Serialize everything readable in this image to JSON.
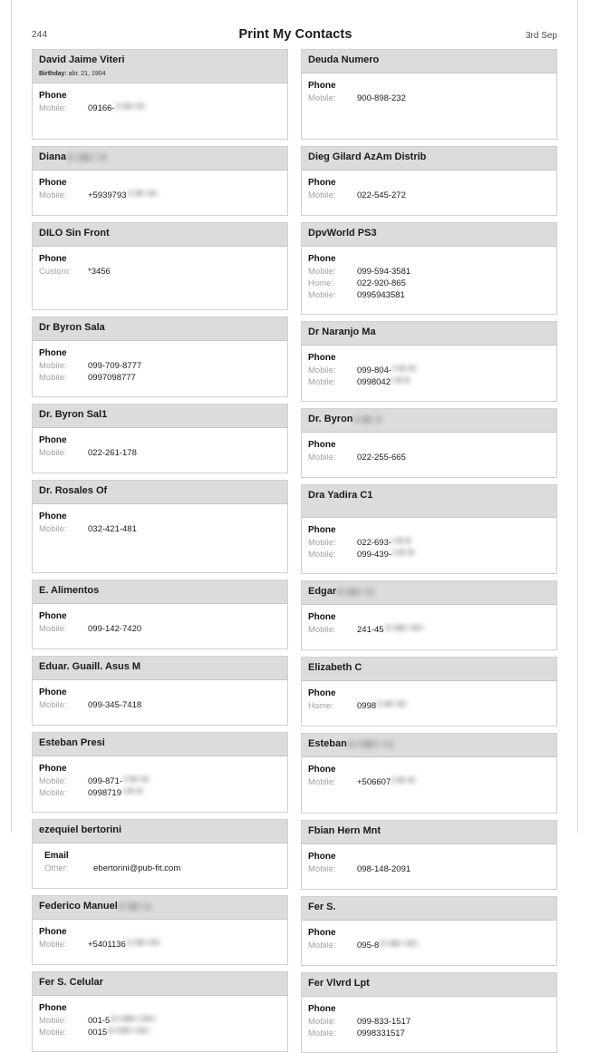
{
  "header": {
    "page_number": "244",
    "title": "Print My Contacts",
    "date": "3rd Sep"
  },
  "labels": {
    "phone_section": "Phone",
    "email_section": "Email",
    "birthday_prefix": "Birthday:"
  },
  "columns": [
    {
      "cards": [
        {
          "name": "David Jaime Viteri",
          "name_redacted": false,
          "birthday": "abr. 21, 1904",
          "section": "Phone",
          "entries": [
            {
              "label": "Mobile:",
              "value": "09166-",
              "redacted": true,
              "redact_width": 34
            }
          ],
          "body_height": 46
        },
        {
          "name": "Diana",
          "name_redacted": true,
          "name_redact_width": 44,
          "section": "Phone",
          "entries": [
            {
              "label": "Mobile:",
              "value": "+5939793",
              "redacted": true,
              "redact_width": 34
            }
          ],
          "body_height": 34
        },
        {
          "name": "DILO Sin Front",
          "name_redacted": false,
          "section": "Phone",
          "entries": [
            {
              "label": "Custom:",
              "value": "*3456",
              "redacted": false
            }
          ],
          "body_height": 54
        },
        {
          "name": "Dr Byron Sala",
          "name_redacted": false,
          "section": "Phone",
          "entries": [
            {
              "label": "Mobile:",
              "value": "099-709-8777",
              "redacted": false
            },
            {
              "label": "Mobile:",
              "value": "0997098777",
              "redacted": false
            }
          ],
          "body_height": 46
        },
        {
          "name": "Dr. Byron Sal1",
          "name_redacted": false,
          "section": "Phone",
          "entries": [
            {
              "label": "Mobile:",
              "value": "022-261-178",
              "redacted": false
            }
          ],
          "body_height": 34
        },
        {
          "name": "Dr. Rosales Of",
          "name_redacted": false,
          "section": "Phone",
          "entries": [
            {
              "label": "Mobile:",
              "value": "032-421-481",
              "redacted": false
            }
          ],
          "body_height": 60
        },
        {
          "name": "E. Alimentos",
          "name_redacted": false,
          "section": "Phone",
          "entries": [
            {
              "label": "Mobile:",
              "value": "099-142-7420",
              "redacted": false
            }
          ],
          "body_height": 34
        },
        {
          "name": "Eduar. Guaill. Asus M",
          "name_redacted": false,
          "section": "Phone",
          "entries": [
            {
              "label": "Mobile:",
              "value": "099-345-7418",
              "redacted": false
            }
          ],
          "body_height": 34
        },
        {
          "name": "Esteban Presi",
          "name_redacted": false,
          "section": "Phone",
          "entries": [
            {
              "label": "Mobile:",
              "value": "099-871-",
              "redacted": true,
              "redact_width": 30
            },
            {
              "label": "Mobile:",
              "value": "0998719",
              "redacted": true,
              "redact_width": 24
            }
          ],
          "body_height": 46
        },
        {
          "name": "ezequiel bertorini",
          "name_redacted": false,
          "section": "Email",
          "indent": true,
          "entries": [
            {
              "label": "Other:",
              "value": "ebertorini@pub-fit.com",
              "redacted": false
            }
          ],
          "body_height": 34
        },
        {
          "name": "Federico Manuel",
          "name_redacted": true,
          "name_redact_width": 36,
          "section": "Phone",
          "entries": [
            {
              "label": "Mobile:",
              "value": "+5401136",
              "redacted": true,
              "redact_width": 38
            }
          ],
          "body_height": 34
        },
        {
          "name": "Fer S. Celular",
          "name_redacted": false,
          "section": "Phone",
          "entries": [
            {
              "label": "Mobile:",
              "value": "001-5",
              "redacted": true,
              "redact_width": 52
            },
            {
              "label": "Mobile:",
              "value": "0015",
              "redacted": true,
              "redact_width": 48
            }
          ],
          "body_height": 46
        }
      ]
    },
    {
      "cards": [
        {
          "name": "Deuda Numero",
          "name_redacted": false,
          "section": "Phone",
          "entries": [
            {
              "label": "Mobile:",
              "value": "900-898-232",
              "redacted": false
            }
          ],
          "body_height": 57
        },
        {
          "name": "Dieg Gilard AzAm Distrib",
          "name_redacted": false,
          "section": "Phone",
          "entries": [
            {
              "label": "Mobile:",
              "value": "022-545-272",
              "redacted": false
            }
          ],
          "body_height": 34
        },
        {
          "name": "DpvWorld PS3",
          "name_redacted": false,
          "section": "Phone",
          "entries": [
            {
              "label": "Mobile:",
              "value": "099-594-3581",
              "redacted": false
            },
            {
              "label": "Home:",
              "value": "022-920-865",
              "redacted": false
            },
            {
              "label": "Mobile:",
              "value": "0995943581",
              "redacted": false
            }
          ],
          "body_height": 59
        },
        {
          "name": "Dr Naranjo Ma",
          "name_redacted": false,
          "section": "Phone",
          "entries": [
            {
              "label": "Mobile:",
              "value": "099-804-",
              "redacted": true,
              "redact_width": 28
            },
            {
              "label": "Mobile:",
              "value": "0998042",
              "redacted": true,
              "redact_width": 22
            }
          ],
          "body_height": 46
        },
        {
          "name": "Dr. Byron",
          "name_redacted": true,
          "name_redact_width": 30,
          "section": "Phone",
          "entries": [
            {
              "label": "Mobile:",
              "value": "022-255-665",
              "redacted": false
            }
          ],
          "body_height": 34
        },
        {
          "name": "Dra Yadira C1",
          "name_redacted": false,
          "header_tall": true,
          "section": "Phone",
          "entries": [
            {
              "label": "Mobile:",
              "value": "022-693-",
              "redacted": true,
              "redact_width": 22
            },
            {
              "label": "Mobile:",
              "value": "099-439-",
              "redacted": true,
              "redact_width": 26
            }
          ],
          "body_height": 46
        },
        {
          "name": "Edgar",
          "name_redacted": true,
          "name_redact_width": 40,
          "section": "Phone",
          "entries": [
            {
              "label": "Mobile:",
              "value": "241-45",
              "redacted": true,
              "redact_width": 44
            }
          ],
          "body_height": 34
        },
        {
          "name": "Elizabeth C",
          "name_redacted": false,
          "section": "Phone",
          "entries": [
            {
              "label": "Home:",
              "value": "0998",
              "redacted": true,
              "redact_width": 34
            }
          ],
          "body_height": 34
        },
        {
          "name": "Esteban",
          "name_redacted": true,
          "name_redact_width": 50,
          "section": "Phone",
          "entries": [
            {
              "label": "Mobile:",
              "value": "+506607",
              "redacted": true,
              "redact_width": 28
            }
          ],
          "body_height": 46
        },
        {
          "name": "Fbian Hern Mnt",
          "name_redacted": false,
          "section": "Phone",
          "entries": [
            {
              "label": "Mobile:",
              "value": "098-148-2091",
              "redacted": false
            }
          ],
          "body_height": 34
        },
        {
          "name": "Fer S.",
          "name_redacted": false,
          "section": "Phone",
          "entries": [
            {
              "label": "Mobile:",
              "value": "095-8",
              "redacted": true,
              "redact_width": 44
            }
          ],
          "body_height": 34
        },
        {
          "name": "Fer Vlvrd Lpt",
          "name_redacted": false,
          "section": "Phone",
          "entries": [
            {
              "label": "Mobile:",
              "value": "099-833-1517",
              "redacted": false
            },
            {
              "label": "Mobile:",
              "value": "0998331517",
              "redacted": false
            }
          ],
          "body_height": 46
        }
      ]
    }
  ]
}
